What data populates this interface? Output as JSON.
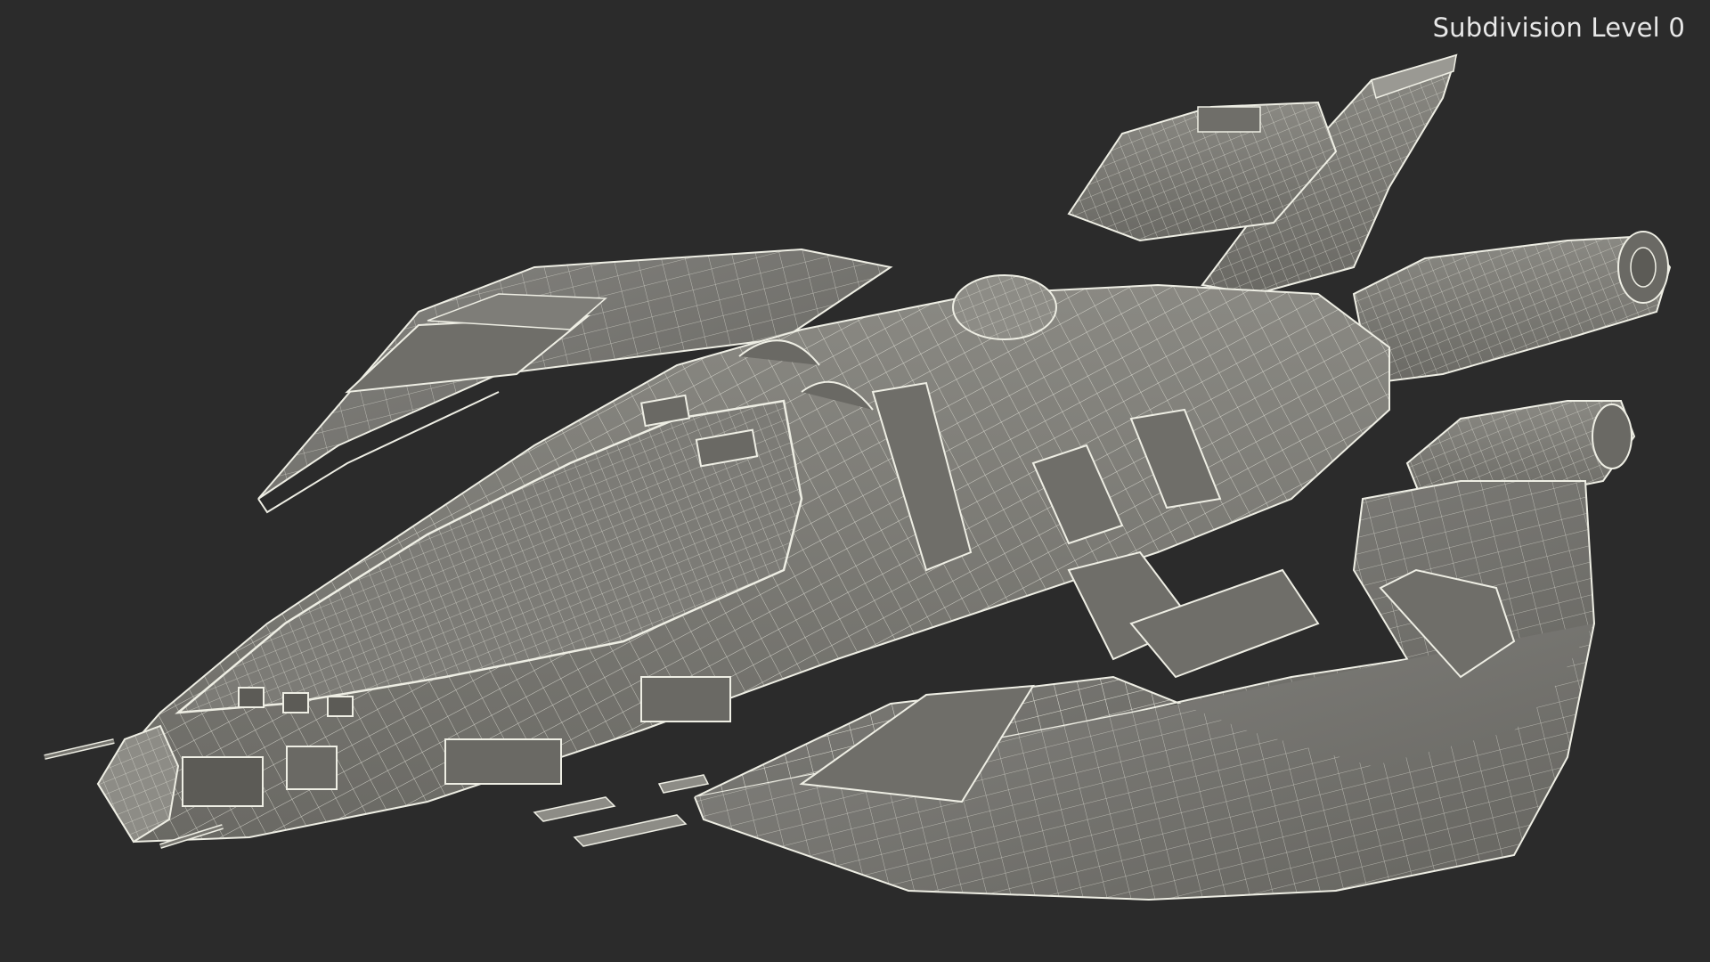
{
  "viewport": {
    "overlay_text": "Subdivision Level 0",
    "background_color": "#2b2b2b",
    "overlay_text_color": "#e8e8e8"
  },
  "model": {
    "surface_color": "#777670",
    "surface_light_color": "#8a8983",
    "surface_dark_color": "#5c5b56",
    "wire_color": "#eeeee4"
  }
}
